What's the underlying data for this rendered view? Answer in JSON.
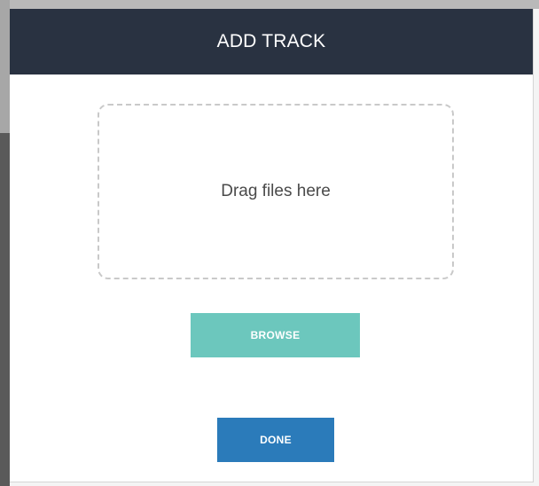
{
  "modal": {
    "title": "ADD TRACK",
    "dropzone_text": "Drag files here",
    "browse_label": "BROWSE",
    "done_label": "DONE"
  },
  "colors": {
    "header_bg": "#293241",
    "browse_bg": "#6cc7bd",
    "done_bg": "#2b7bba",
    "dropzone_border": "#c9c9c9"
  }
}
